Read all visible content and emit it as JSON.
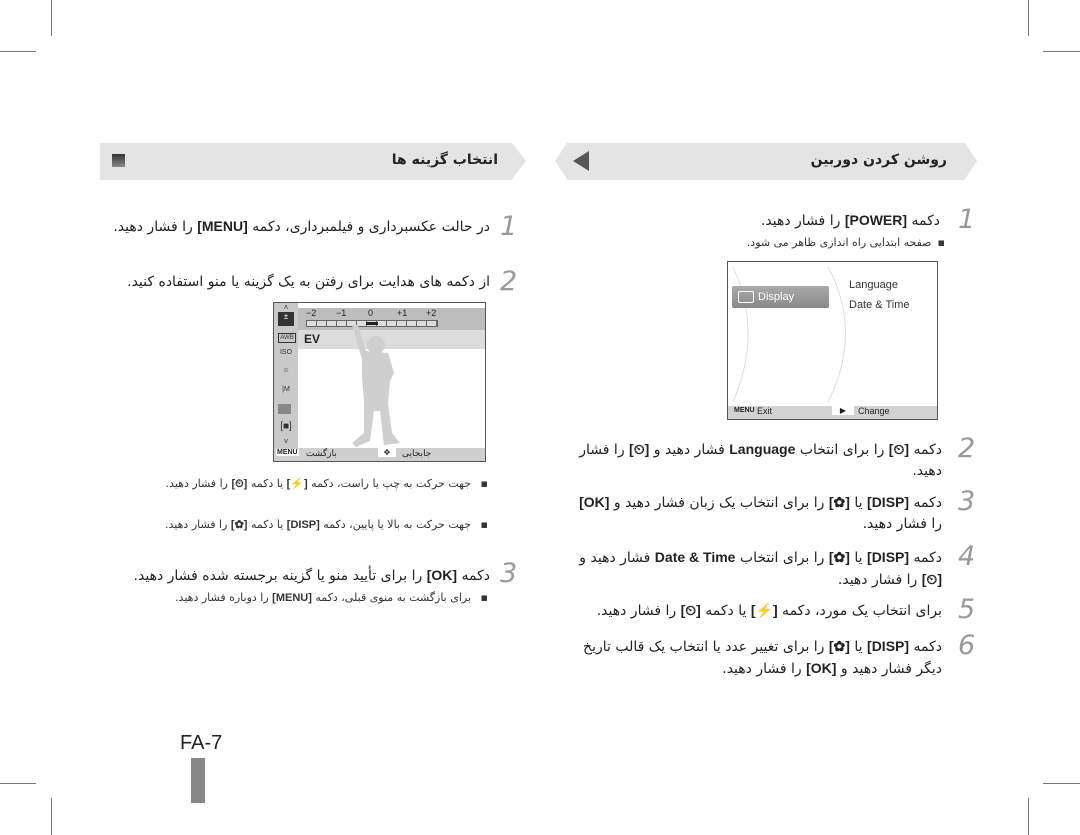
{
  "page": {
    "page_number": "FA-7",
    "colors": {
      "header_bg": "#e4e4e4",
      "step_number": "#999999",
      "tab_marker": "#888888"
    }
  },
  "left": {
    "header": {
      "title": "انتخاب گزینه ها",
      "icon": "square-marker-icon"
    },
    "steps": [
      {
        "num": "1",
        "text_a": "در حالت عکسبرداری و فیلمبرداری، دکمه ",
        "key": "[MENU]",
        "text_b": " را فشار دهید."
      },
      {
        "num": "2",
        "text": "از دکمه های هدایت برای رفتن به یک گزینه یا منو استفاده کنید."
      },
      {
        "num": "3",
        "text_a": "دکمه ",
        "key": "[OK]",
        "text_b": " را برای تأیید منو یا گزینه برجسته شده فشار دهید."
      }
    ],
    "bullets_step2": [
      {
        "text_a": "جهت حرکت به چپ یا راست، دکمه ",
        "key1": "[⚡]",
        "text_b": " یا دکمه ",
        "key2": "[⏲]",
        "text_c": " را فشار دهید."
      },
      {
        "text_a": "جهت حرکت به بالا یا پایین، دکمه ",
        "key1": "[DISP]",
        "text_b": " یا دکمه ",
        "key2": "[✿]",
        "text_c": " را فشار دهید."
      }
    ],
    "bullets_step3": [
      {
        "text_a": "برای بازگشت به منوی قبلی، دکمه ",
        "key": "[MENU]",
        "text_b": " را دوباره فشار دهید."
      }
    ],
    "camera_screen": {
      "ev_label": "EV",
      "ev_scale": [
        "−2",
        "−1",
        "0",
        "+1",
        "+2"
      ],
      "ev_value": 0,
      "side_icons": [
        "up-arrow-icon",
        "exposure-icon",
        "awb-icon",
        "iso-icon",
        "face-off-icon",
        "resolution-icon",
        "quality-icon",
        "metering-icon",
        "down-arrow-icon"
      ],
      "bottom_left_key": "MENU",
      "bottom_left_label": "بازگشت",
      "bottom_right_label": "جابجایی"
    }
  },
  "right": {
    "header": {
      "title": "روشن کردن دوربین",
      "icon": "triangle-left-icon"
    },
    "steps": [
      {
        "num": "1",
        "text_a": "دکمه ",
        "key": "[POWER]",
        "text_b": " را فشار دهید."
      },
      {
        "num": "2",
        "text_a": "دکمه ",
        "key1": "[⏲]",
        "text_b": " را برای انتخاب ",
        "word": "Language",
        "text_c": " فشار دهید و ",
        "key2": "[⏲]",
        "text_d": " را فشار دهید."
      },
      {
        "num": "3",
        "text_a": "دکمه ",
        "key1": "[DISP]",
        "text_b": " یا ",
        "key2": "[✿]",
        "text_c": " را برای انتخاب یک زبان فشار دهید و ",
        "key3": "[OK]",
        "text_d": " را فشار دهید."
      },
      {
        "num": "4",
        "text_a": "دکمه ",
        "key1": "[DISP]",
        "text_b": " یا ",
        "key2": "[✿]",
        "text_c": " را برای انتخاب ",
        "word": "Date & Time",
        "text_d": " فشار دهید و ",
        "key3": "[⏲]",
        "text_e": " را فشار دهید."
      },
      {
        "num": "5",
        "text_a": "برای انتخاب یک مورد، دکمه ",
        "key1": "[⚡]",
        "text_b": " یا دکمه ",
        "key2": "[⏲]",
        "text_c": " را فشار دهید."
      },
      {
        "num": "6",
        "text_a": "دکمه ",
        "key1": "[DISP]",
        "text_b": " یا ",
        "key2": "[✿]",
        "text_c": " را برای تغییر عدد یا انتخاب یک قالب تاریخ دیگر فشار دهید و ",
        "key3": "[OK]",
        "text_d": " را فشار دهید."
      }
    ],
    "bullets_step1": [
      {
        "text": "صفحه ابتدایی راه اندازی ظاهر می شود."
      }
    ],
    "camera_screen": {
      "selected_tab": "Display",
      "menu_items": [
        "Language",
        "Date & Time"
      ],
      "bottom_left_key": "MENU",
      "bottom_left_label": "Exit",
      "bottom_right_label": "Change"
    }
  }
}
